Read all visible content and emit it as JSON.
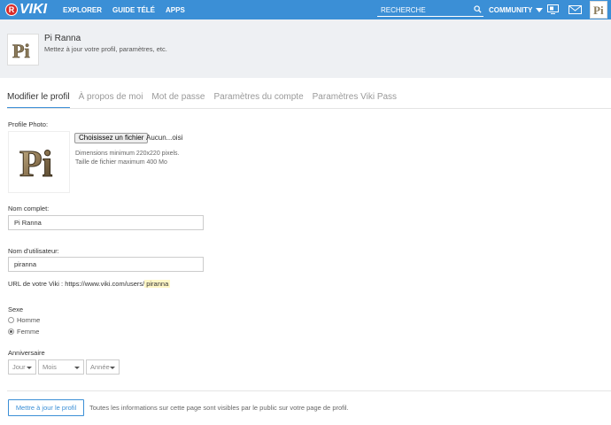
{
  "topbar": {
    "logo_badge": "R",
    "logo_text": "VIKI",
    "nav": [
      "EXPLORER",
      "GUIDE TÉLÉ",
      "APPS"
    ],
    "search_placeholder": "RECHERCHE",
    "community": "COMMUNITY",
    "icons": [
      "search-icon",
      "tv-icon",
      "mail-icon",
      "avatar"
    ],
    "brand_color": "#3b8fd6"
  },
  "header": {
    "name": "Pi Ranna",
    "subtitle": "Mettez à jour votre profil, paramètres, etc."
  },
  "tabs": [
    {
      "label": "Modifier le profil",
      "active": true
    },
    {
      "label": "À propos de moi",
      "active": false
    },
    {
      "label": "Mot de passe",
      "active": false
    },
    {
      "label": "Paramètres du compte",
      "active": false
    },
    {
      "label": "Paramètres Viki Pass",
      "active": false
    }
  ],
  "form": {
    "photo_label": "Profile Photo:",
    "file_button": "Choisissez un fichier",
    "file_name": "Aucun...oisi",
    "hint_dimensions": "Dimensions minimum 220x220 pixels.",
    "hint_size": "Taille de fichier maximum 400 Mo",
    "full_name_label": "Nom complet:",
    "full_name_value": "Pi Ranna",
    "username_label": "Nom d'utilisateur:",
    "username_value": "piranna",
    "url_prefix": "URL de votre Viki : https://www.viki.com/users/",
    "url_username": "piranna",
    "sex_label": "Sexe",
    "sex_options": [
      {
        "label": "Homme",
        "selected": false
      },
      {
        "label": "Femme",
        "selected": true
      }
    ],
    "birthday_label": "Anniversaire",
    "day": "Jour",
    "month": "Mois",
    "year": "Année"
  },
  "footer": {
    "submit": "Mettre à jour le profil",
    "note": "Toutes les informations sur cette page sont visibles par le public sur votre page de profil."
  },
  "avatar_glyph": "Pi"
}
